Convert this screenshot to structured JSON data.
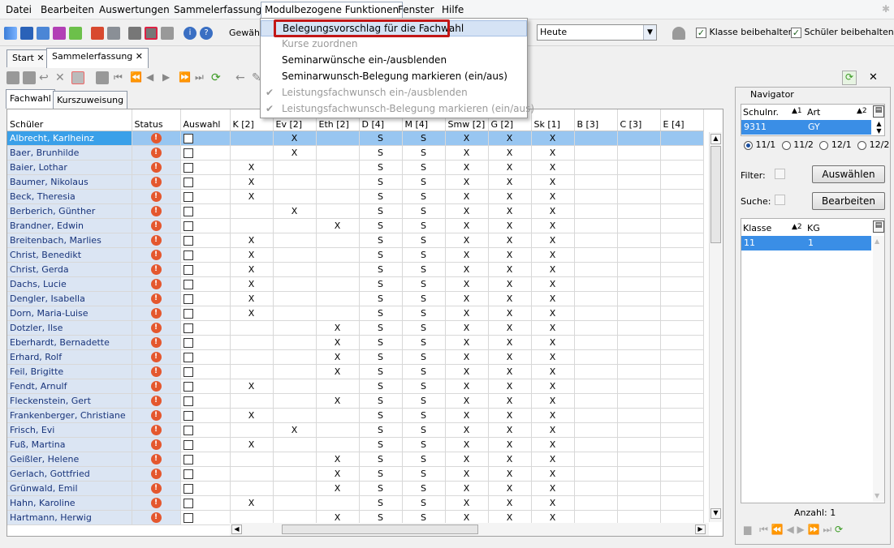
{
  "menubar": [
    "Datei",
    "Bearbeiten",
    "Auswertungen",
    "Sammelerfassung",
    "Modulbezogene Funktionen",
    "Fenster",
    "Hilfe"
  ],
  "toolbar": {
    "gewaehlt_label": "Gewähl",
    "date_combo": "Heute",
    "keep_class_label": "Klasse beibehalten",
    "keep_student_label": "Schüler beibehalten"
  },
  "tabs": [
    "Start",
    "Sammelerfassung"
  ],
  "subtabs": [
    "Fachwahl",
    "Kurszuweisung"
  ],
  "dropdown": [
    {
      "label": "Belegungsvorschlag für die Fachwahl",
      "state": "highlight"
    },
    {
      "label": "Kurse zuordnen",
      "state": "disabled"
    },
    {
      "label": "Seminarwünsche ein-/ausblenden",
      "state": "normal"
    },
    {
      "label": "Seminarwunsch-Belegung markieren (ein/aus)",
      "state": "normal"
    },
    {
      "label": "Leistungsfachwunsch ein-/ausblenden",
      "state": "disabled-check"
    },
    {
      "label": "Leistungsfachwunsch-Belegung markieren (ein/aus)",
      "state": "disabled-check"
    }
  ],
  "grid": {
    "columns": [
      "Schüler",
      "Status",
      "Auswahl",
      "K [2]",
      "Ev [2]",
      "Eth [2]",
      "D [4]",
      "M [4]",
      "Smw [2]",
      "G [2]",
      "Sk [1]",
      "B [3]",
      "C [3]",
      "E [4]"
    ],
    "rows": [
      {
        "name": "Albrecht, Karlheinz",
        "cells": [
          "",
          "X",
          "",
          "S",
          "S",
          "X",
          "X",
          "X",
          "",
          "",
          ""
        ],
        "selected": true
      },
      {
        "name": "Baer, Brunhilde",
        "cells": [
          "",
          "X",
          "",
          "S",
          "S",
          "X",
          "X",
          "X",
          "",
          "",
          ""
        ]
      },
      {
        "name": "Baier, Lothar",
        "cells": [
          "X",
          "",
          "",
          "S",
          "S",
          "X",
          "X",
          "X",
          "",
          "",
          ""
        ]
      },
      {
        "name": "Baumer, Nikolaus",
        "cells": [
          "X",
          "",
          "",
          "S",
          "S",
          "X",
          "X",
          "X",
          "",
          "",
          ""
        ]
      },
      {
        "name": "Beck, Theresia",
        "cells": [
          "X",
          "",
          "",
          "S",
          "S",
          "X",
          "X",
          "X",
          "",
          "",
          ""
        ]
      },
      {
        "name": "Berberich, Günther",
        "cells": [
          "",
          "X",
          "",
          "S",
          "S",
          "X",
          "X",
          "X",
          "",
          "",
          ""
        ]
      },
      {
        "name": "Brandner, Edwin",
        "cells": [
          "",
          "",
          "X",
          "S",
          "S",
          "X",
          "X",
          "X",
          "",
          "",
          ""
        ]
      },
      {
        "name": "Breitenbach, Marlies",
        "cells": [
          "X",
          "",
          "",
          "S",
          "S",
          "X",
          "X",
          "X",
          "",
          "",
          ""
        ]
      },
      {
        "name": "Christ, Benedikt",
        "cells": [
          "X",
          "",
          "",
          "S",
          "S",
          "X",
          "X",
          "X",
          "",
          "",
          ""
        ]
      },
      {
        "name": "Christ, Gerda",
        "cells": [
          "X",
          "",
          "",
          "S",
          "S",
          "X",
          "X",
          "X",
          "",
          "",
          ""
        ]
      },
      {
        "name": "Dachs, Lucie",
        "cells": [
          "X",
          "",
          "",
          "S",
          "S",
          "X",
          "X",
          "X",
          "",
          "",
          ""
        ]
      },
      {
        "name": "Dengler, Isabella",
        "cells": [
          "X",
          "",
          "",
          "S",
          "S",
          "X",
          "X",
          "X",
          "",
          "",
          ""
        ]
      },
      {
        "name": "Dorn, Maria-Luise",
        "cells": [
          "X",
          "",
          "",
          "S",
          "S",
          "X",
          "X",
          "X",
          "",
          "",
          ""
        ]
      },
      {
        "name": "Dotzler, Ilse",
        "cells": [
          "",
          "",
          "X",
          "S",
          "S",
          "X",
          "X",
          "X",
          "",
          "",
          ""
        ]
      },
      {
        "name": "Eberhardt, Bernadette",
        "cells": [
          "",
          "",
          "X",
          "S",
          "S",
          "X",
          "X",
          "X",
          "",
          "",
          ""
        ]
      },
      {
        "name": "Erhard, Rolf",
        "cells": [
          "",
          "",
          "X",
          "S",
          "S",
          "X",
          "X",
          "X",
          "",
          "",
          ""
        ]
      },
      {
        "name": "Feil, Brigitte",
        "cells": [
          "",
          "",
          "X",
          "S",
          "S",
          "X",
          "X",
          "X",
          "",
          "",
          ""
        ]
      },
      {
        "name": "Fendt, Arnulf",
        "cells": [
          "X",
          "",
          "",
          "S",
          "S",
          "X",
          "X",
          "X",
          "",
          "",
          ""
        ]
      },
      {
        "name": "Fleckenstein, Gert",
        "cells": [
          "",
          "",
          "X",
          "S",
          "S",
          "X",
          "X",
          "X",
          "",
          "",
          ""
        ]
      },
      {
        "name": "Frankenberger, Christiane",
        "cells": [
          "X",
          "",
          "",
          "S",
          "S",
          "X",
          "X",
          "X",
          "",
          "",
          ""
        ]
      },
      {
        "name": "Frisch, Evi",
        "cells": [
          "",
          "X",
          "",
          "S",
          "S",
          "X",
          "X",
          "X",
          "",
          "",
          ""
        ]
      },
      {
        "name": "Fuß, Martina",
        "cells": [
          "X",
          "",
          "",
          "S",
          "S",
          "X",
          "X",
          "X",
          "",
          "",
          ""
        ]
      },
      {
        "name": "Geißler, Helene",
        "cells": [
          "",
          "",
          "X",
          "S",
          "S",
          "X",
          "X",
          "X",
          "",
          "",
          ""
        ]
      },
      {
        "name": "Gerlach, Gottfried",
        "cells": [
          "",
          "",
          "X",
          "S",
          "S",
          "X",
          "X",
          "X",
          "",
          "",
          ""
        ]
      },
      {
        "name": "Grünwald, Emil",
        "cells": [
          "",
          "",
          "X",
          "S",
          "S",
          "X",
          "X",
          "X",
          "",
          "",
          ""
        ]
      },
      {
        "name": "Hahn, Karoline",
        "cells": [
          "X",
          "",
          "",
          "S",
          "S",
          "X",
          "X",
          "X",
          "",
          "",
          ""
        ]
      },
      {
        "name": "Hartmann, Herwig",
        "cells": [
          "",
          "",
          "X",
          "S",
          "S",
          "X",
          "X",
          "X",
          "",
          "",
          ""
        ]
      }
    ]
  },
  "navigator": {
    "title": "Navigator",
    "school_grid": {
      "col1": "Schulnr.",
      "col1_sort": "1",
      "col2": "Art",
      "col2_sort": "2",
      "row": [
        "9311",
        "GY"
      ]
    },
    "radios": [
      {
        "label": "11/1",
        "checked": true
      },
      {
        "label": "11/2",
        "checked": false
      },
      {
        "label": "12/1",
        "checked": false
      },
      {
        "label": "12/2",
        "checked": false
      }
    ],
    "filter_label": "Filter:",
    "select_button": "Auswählen",
    "search_label": "Suche:",
    "edit_button": "Bearbeiten",
    "class_grid": {
      "col1": "Klasse",
      "col1_sort": "2",
      "col2": "KG",
      "row": [
        "11",
        "1"
      ]
    },
    "count_label": "Anzahl: 1"
  }
}
